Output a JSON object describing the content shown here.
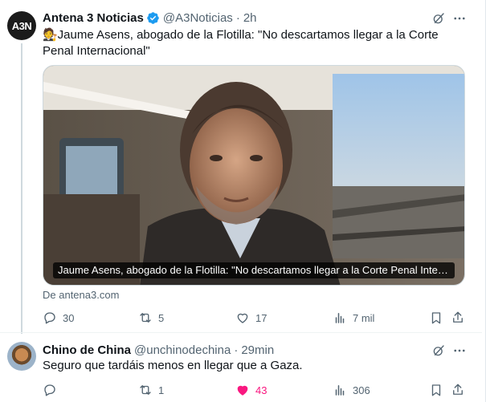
{
  "tweets": [
    {
      "author_name": "Antena 3 Noticias",
      "avatar_text": "A3N",
      "handle": "@A3Noticias",
      "separator": "·",
      "time": "2h",
      "text": "🧑‍⚖️Jaume Asens, abogado de la Flotilla: \"No descartamos llegar a la Corte Penal Internacional\"",
      "media_caption": "Jaume Asens, abogado de la Flotilla: \"No descartamos llegar a la Corte Penal Internacio…",
      "source": "De antena3.com",
      "replies": "30",
      "reposts": "5",
      "likes": "17",
      "views": "7 mil",
      "verified": true
    },
    {
      "author_name": "Chino de China",
      "handle": "@unchinodechina",
      "separator": "·",
      "time": "29min",
      "text": "Seguro que tardáis menos en llegar que a Gaza.",
      "replies": "",
      "reposts": "1",
      "likes": "43",
      "views": "306",
      "liked": true
    }
  ],
  "colors": {
    "text_primary": "#0f1419",
    "text_secondary": "#536471",
    "verified": "#1d9bf0",
    "like_active": "#f91880"
  },
  "icons": [
    "verified-badge-icon",
    "grok-icon",
    "more-icon",
    "reply-icon",
    "repost-icon",
    "like-icon",
    "views-icon",
    "bookmark-icon",
    "share-icon"
  ]
}
